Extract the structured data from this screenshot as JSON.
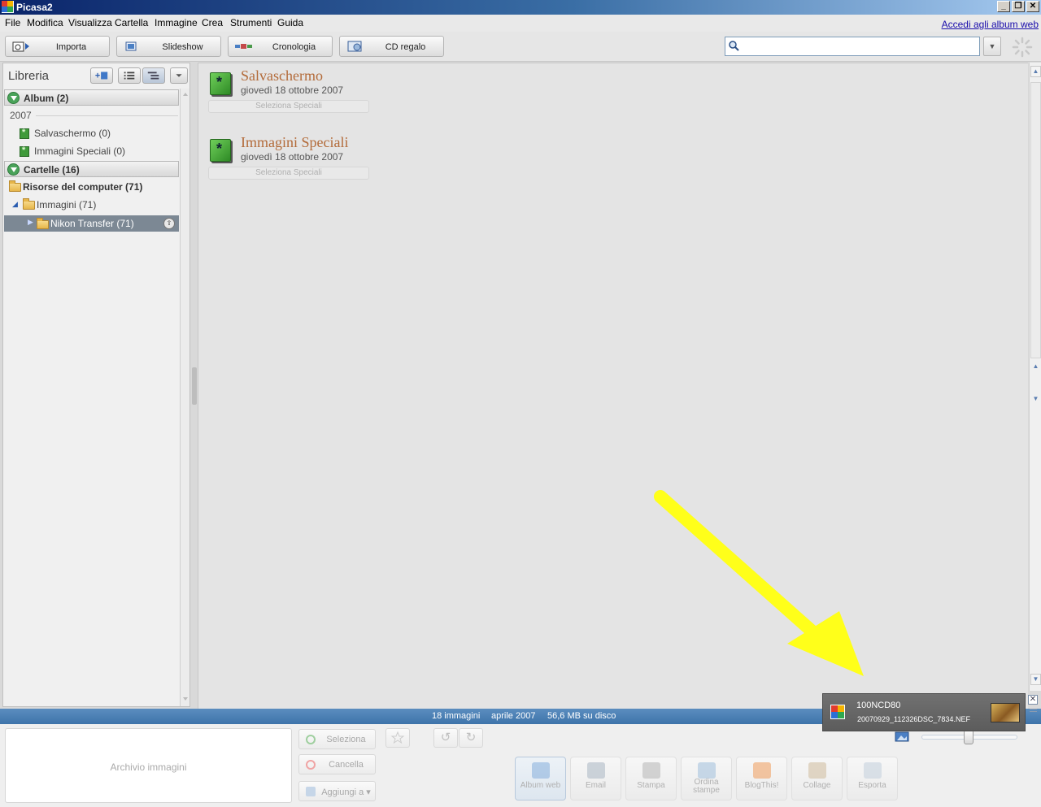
{
  "window": {
    "title": "Picasa2"
  },
  "menu": {
    "items": [
      "File",
      "Modifica",
      "Visualizza",
      "Cartella",
      "Immagine",
      "Crea",
      "Strumenti",
      "Guida"
    ],
    "signin_link": "Accedi agli album web"
  },
  "toolbar": {
    "buttons": [
      "Importa",
      "Slideshow",
      "Cronologia",
      "CD regalo"
    ],
    "search": {
      "value": "",
      "placeholder": ""
    }
  },
  "library": {
    "title": "Libreria",
    "album_section": "Album (2)",
    "year": "2007",
    "albums": [
      "Salvaschermo (0)",
      "Immagini Speciali (0)"
    ],
    "folder_section": "Cartelle (16)",
    "computer_node": "Risorse del computer (71)",
    "images_node": "Immagini (71)",
    "selected_folder": "Nikon Transfer (71)"
  },
  "main": {
    "albums": [
      {
        "title": "Salvaschermo",
        "date": "giovedì 18 ottobre 2007",
        "select_label": "Seleziona Speciali"
      },
      {
        "title": "Immagini Speciali",
        "date": "giovedì 18 ottobre 2007",
        "select_label": "Seleziona Speciali"
      }
    ]
  },
  "status": {
    "count": "18 immagini",
    "date": "aprile 2007",
    "size": "56,6 MB su disco"
  },
  "bottom": {
    "tray_label": "Archivio immagini",
    "select_label": "Seleziona",
    "clear_label": "Cancella",
    "add_label": "Aggiungi a ▾",
    "actions": [
      "Album web",
      "Email",
      "Stampa",
      "Ordina stampe",
      "BlogThis!",
      "Collage",
      "Esporta"
    ]
  },
  "notification": {
    "folder": "100NCD80",
    "file": "20070929_112326DSC_7834.NEF"
  },
  "colors": {
    "title_bar": "#0a246a",
    "status_bar": "#4a7fb4",
    "album_title": "#b36b3a",
    "annotation_arrow": "#ffff1a"
  }
}
